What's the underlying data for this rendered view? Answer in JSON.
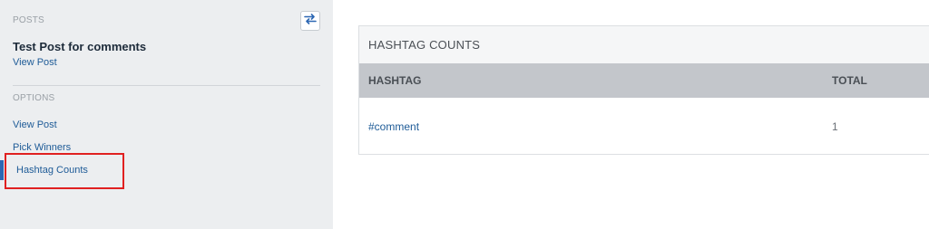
{
  "sidebar": {
    "posts_label": "POSTS",
    "post_title": "Test Post for comments",
    "view_post_link": "View Post",
    "options_label": "OPTIONS",
    "options": [
      {
        "label": "View Post"
      },
      {
        "label": "Pick Winners"
      },
      {
        "label": "Hashtag Counts",
        "active": true
      }
    ],
    "swap_icon": "swap-arrows-icon"
  },
  "panel": {
    "title": "HASHTAG COUNTS",
    "columns": [
      "HASHTAG",
      "TOTAL"
    ],
    "rows": [
      {
        "hashtag": "#comment",
        "total": "1"
      }
    ]
  },
  "colors": {
    "accent": "#2c67b3",
    "link": "#1e5b97",
    "highlight": "#e02020"
  }
}
